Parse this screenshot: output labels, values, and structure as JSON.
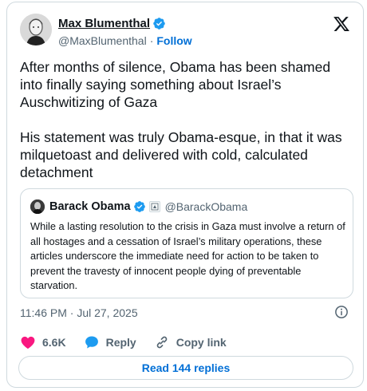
{
  "author": {
    "name": "Max Blumenthal",
    "handle": "@MaxBlumenthal",
    "separator": "·",
    "follow_label": "Follow",
    "verified_icon": "verified-badge-icon",
    "verified_color": "#1d9bf0"
  },
  "platform_icon": "x-logo-icon",
  "tweet_text": "After months of silence, Obama has been shamed into finally saying something about Israel’s Auschwitizing of Gaza\n\nHis statement was truly Obama-esque, in that it was milquetoast and delivered with cold, calculated detachment",
  "quoted": {
    "name": "Barack Obama",
    "handle": "@BarackObama",
    "text": "While a lasting resolution to the crisis in Gaza must involve a return of all hostages and a cessation of Israel’s military operations, these articles underscore the immediate need for action to be taken to prevent the travesty of innocent people dying of preventable starvation."
  },
  "timestamp": "11:46 PM · Jul 27, 2025",
  "actions": {
    "likes": "6.6K",
    "reply_label": "Reply",
    "copy_label": "Copy link",
    "like_color": "#f91880",
    "accent_color": "#1d9bf0"
  },
  "read_replies_label": "Read 144 replies"
}
